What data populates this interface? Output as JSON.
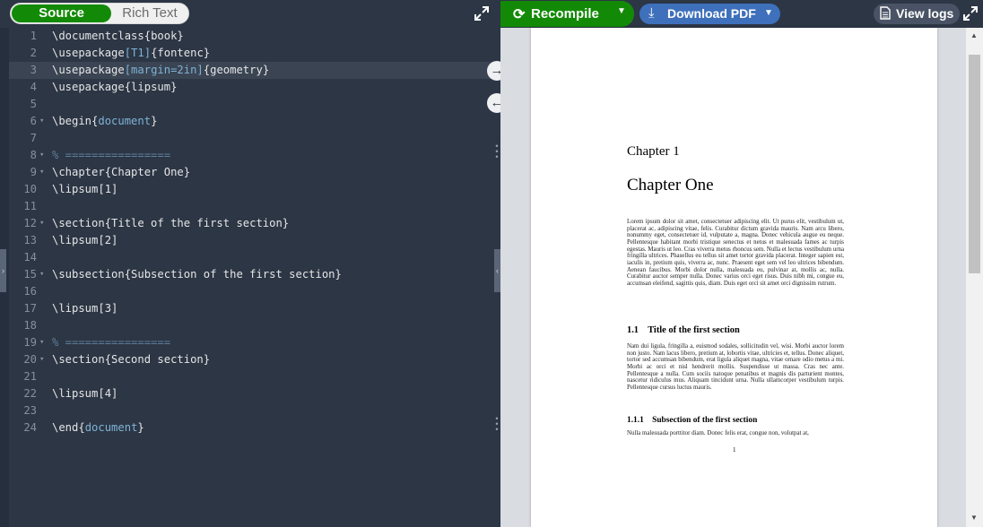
{
  "editor": {
    "mode_source": "Source",
    "mode_rich": "Rich Text",
    "lines": [
      {
        "n": "1",
        "fold": "",
        "parts": [
          {
            "t": "\\documentclass",
            "c": "kw"
          },
          {
            "t": "{book}",
            "c": "plain"
          }
        ]
      },
      {
        "n": "2",
        "fold": "",
        "parts": [
          {
            "t": "\\usepackage",
            "c": "kw"
          },
          {
            "t": "[T1]",
            "c": "arg"
          },
          {
            "t": "{fontenc}",
            "c": "plain"
          }
        ]
      },
      {
        "n": "3",
        "fold": "",
        "active": true,
        "parts": [
          {
            "t": "\\usepackage",
            "c": "kw"
          },
          {
            "t": "[margin=2in]",
            "c": "arg"
          },
          {
            "t": "{geometry}",
            "c": "plain"
          }
        ]
      },
      {
        "n": "4",
        "fold": "",
        "parts": [
          {
            "t": "\\usepackage",
            "c": "kw"
          },
          {
            "t": "{lipsum}",
            "c": "plain"
          }
        ]
      },
      {
        "n": "5",
        "fold": "",
        "parts": []
      },
      {
        "n": "6",
        "fold": "▾",
        "parts": [
          {
            "t": "\\begin",
            "c": "kw"
          },
          {
            "t": "{",
            "c": "plain"
          },
          {
            "t": "document",
            "c": "arg"
          },
          {
            "t": "}",
            "c": "plain"
          }
        ]
      },
      {
        "n": "7",
        "fold": "",
        "parts": []
      },
      {
        "n": "8",
        "fold": "▾",
        "parts": [
          {
            "t": "% ================",
            "c": "cm"
          }
        ]
      },
      {
        "n": "9",
        "fold": "▾",
        "parts": [
          {
            "t": "\\chapter{Chapter One}",
            "c": "plain"
          }
        ]
      },
      {
        "n": "10",
        "fold": "",
        "parts": [
          {
            "t": "\\lipsum[1]",
            "c": "plain"
          }
        ]
      },
      {
        "n": "11",
        "fold": "",
        "parts": []
      },
      {
        "n": "12",
        "fold": "▾",
        "parts": [
          {
            "t": "\\section{Title of the first section}",
            "c": "plain"
          }
        ]
      },
      {
        "n": "13",
        "fold": "",
        "parts": [
          {
            "t": "\\lipsum[2]",
            "c": "plain"
          }
        ]
      },
      {
        "n": "14",
        "fold": "",
        "parts": []
      },
      {
        "n": "15",
        "fold": "▾",
        "parts": [
          {
            "t": "\\subsection{Subsection of the first section}",
            "c": "plain"
          }
        ]
      },
      {
        "n": "16",
        "fold": "",
        "parts": []
      },
      {
        "n": "17",
        "fold": "",
        "parts": [
          {
            "t": "\\lipsum[3]",
            "c": "plain"
          }
        ]
      },
      {
        "n": "18",
        "fold": "",
        "parts": []
      },
      {
        "n": "19",
        "fold": "▾",
        "parts": [
          {
            "t": "% ================",
            "c": "cm"
          }
        ]
      },
      {
        "n": "20",
        "fold": "▾",
        "parts": [
          {
            "t": "\\section{Second section}",
            "c": "plain"
          }
        ]
      },
      {
        "n": "21",
        "fold": "",
        "parts": []
      },
      {
        "n": "22",
        "fold": "",
        "parts": [
          {
            "t": "\\lipsum[4]",
            "c": "plain"
          }
        ]
      },
      {
        "n": "23",
        "fold": "",
        "parts": []
      },
      {
        "n": "24",
        "fold": "",
        "parts": [
          {
            "t": "\\end",
            "c": "kw"
          },
          {
            "t": "{",
            "c": "plain"
          },
          {
            "t": "document",
            "c": "arg"
          },
          {
            "t": "}",
            "c": "plain"
          }
        ]
      }
    ]
  },
  "toolbar": {
    "recompile_label": "Recompile",
    "download_label": "Download PDF",
    "view_logs_label": "View logs",
    "recompile_icon": "refresh-icon",
    "download_icon": "download-icon",
    "logs_icon": "document-icon"
  },
  "pdf": {
    "chapter_label": "Chapter 1",
    "chapter_title": "Chapter One",
    "para1": "Lorem ipsum dolor sit amet, consectetuer adipiscing elit. Ut purus elit, vestibulum ut, placerat ac, adipiscing vitae, felis. Curabitur dictum gravida mauris. Nam arcu libero, nonummy eget, consectetuer id, vulputate a, magna. Donec vehicula augue eu neque. Pellentesque habitant morbi tristique senectus et netus et malesuada fames ac turpis egestas. Mauris ut leo. Cras viverra metus rhoncus sem. Nulla et lectus vestibulum urna fringilla ultrices. Phasellus eu tellus sit amet tortor gravida placerat. Integer sapien est, iaculis in, pretium quis, viverra ac, nunc. Praesent eget sem vel leo ultrices bibendum. Aenean faucibus. Morbi dolor nulla, malesuada eu, pulvinar at, mollis ac, nulla. Curabitur auctor semper nulla. Donec varius orci eget risus. Duis nibh mi, congue eu, accumsan eleifend, sagittis quis, diam. Duis eget orci sit amet orci dignissim rutrum.",
    "section1": "1.1    Title of the first section",
    "para2": "Nam dui ligula, fringilla a, euismod sodales, sollicitudin vel, wisi. Morbi auctor lorem non justo. Nam lacus libero, pretium at, lobortis vitae, ultricies et, tellus. Donec aliquet, tortor sed accumsan bibendum, erat ligula aliquet magna, vitae ornare odio metus a mi. Morbi ac orci et nisl hendrerit mollis. Suspendisse ut massa. Cras nec ante. Pellentesque a nulla. Cum sociis natoque penatibus et magnis dis parturient montes, nascetur ridiculus mus. Aliquam tincidunt urna. Nulla ullamcorper vestibulum turpis. Pellentesque cursus luctus mauris.",
    "subsection1": "1.1.1    Subsection of the first section",
    "para3": "Nulla malesuada porttitor diam. Donec felis erat, congue non, volutpat at,",
    "page_number": "1"
  }
}
